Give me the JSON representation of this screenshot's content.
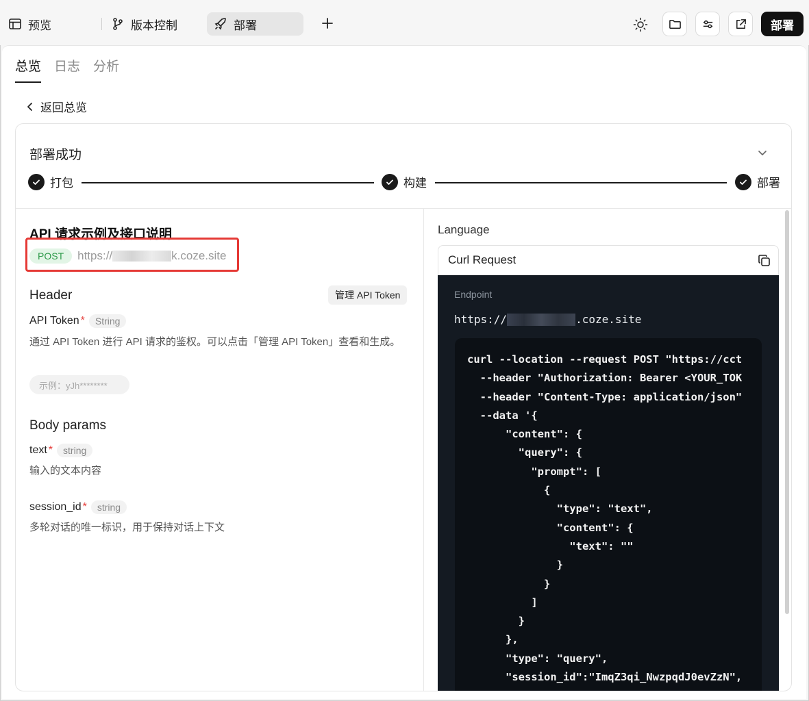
{
  "topbar": {
    "preview_label": "预览",
    "version_label": "版本控制",
    "deploy_tab_label": "部署",
    "deploy_button_label": "部署"
  },
  "tabs": [
    {
      "label": "总览",
      "active": true
    },
    {
      "label": "日志",
      "active": false
    },
    {
      "label": "分析",
      "active": false
    }
  ],
  "back_label": "返回总览",
  "deploy_card": {
    "title": "部署成功",
    "steps": [
      "打包",
      "构建",
      "部署"
    ]
  },
  "api": {
    "title": "API 请求示例及接口说明",
    "method": "POST",
    "url_prefix": "https://",
    "url_suffix": "k.coze.site",
    "header_label": "Header",
    "manage_token_label": "管理 API Token",
    "token_param": {
      "name": "API Token",
      "required_mark": "*",
      "type": "String",
      "desc": "通过 API Token 进行 API 请求的鉴权。可以点击「管理 API Token」查看和生成。",
      "example": "示例：yJh********"
    },
    "body_label": "Body params",
    "params": [
      {
        "name": "text",
        "required_mark": "*",
        "type": "string",
        "desc": "输入的文本内容"
      },
      {
        "name": "session_id",
        "required_mark": "*",
        "type": "string",
        "desc": "多轮对话的唯一标识，用于保持对话上下文"
      }
    ]
  },
  "right": {
    "language_label": "Language",
    "selected_language": "Curl Request",
    "endpoint_label": "Endpoint",
    "endpoint_prefix": "https://",
    "endpoint_suffix": ".coze.site",
    "code": "curl --location --request POST \"https://cct\n  --header \"Authorization: Bearer <YOUR_TOK\n  --header \"Content-Type: application/json\"\n  --data '{\n      \"content\": {\n        \"query\": {\n          \"prompt\": [\n            {\n              \"type\": \"text\",\n              \"content\": {\n                \"text\": \"\"\n              }\n            }\n          ]\n        }\n      },\n      \"type\": \"query\",\n      \"session_id\":\"ImqZ3qi_NwzpqdJ0evZzN\","
  },
  "colors": {
    "accent_dark": "#111111",
    "post_badge_bg": "#e2f5e6",
    "post_badge_text": "#2e9a4a",
    "required": "#e53935",
    "code_bg": "#141a22",
    "highlight_box": "#e53935"
  }
}
